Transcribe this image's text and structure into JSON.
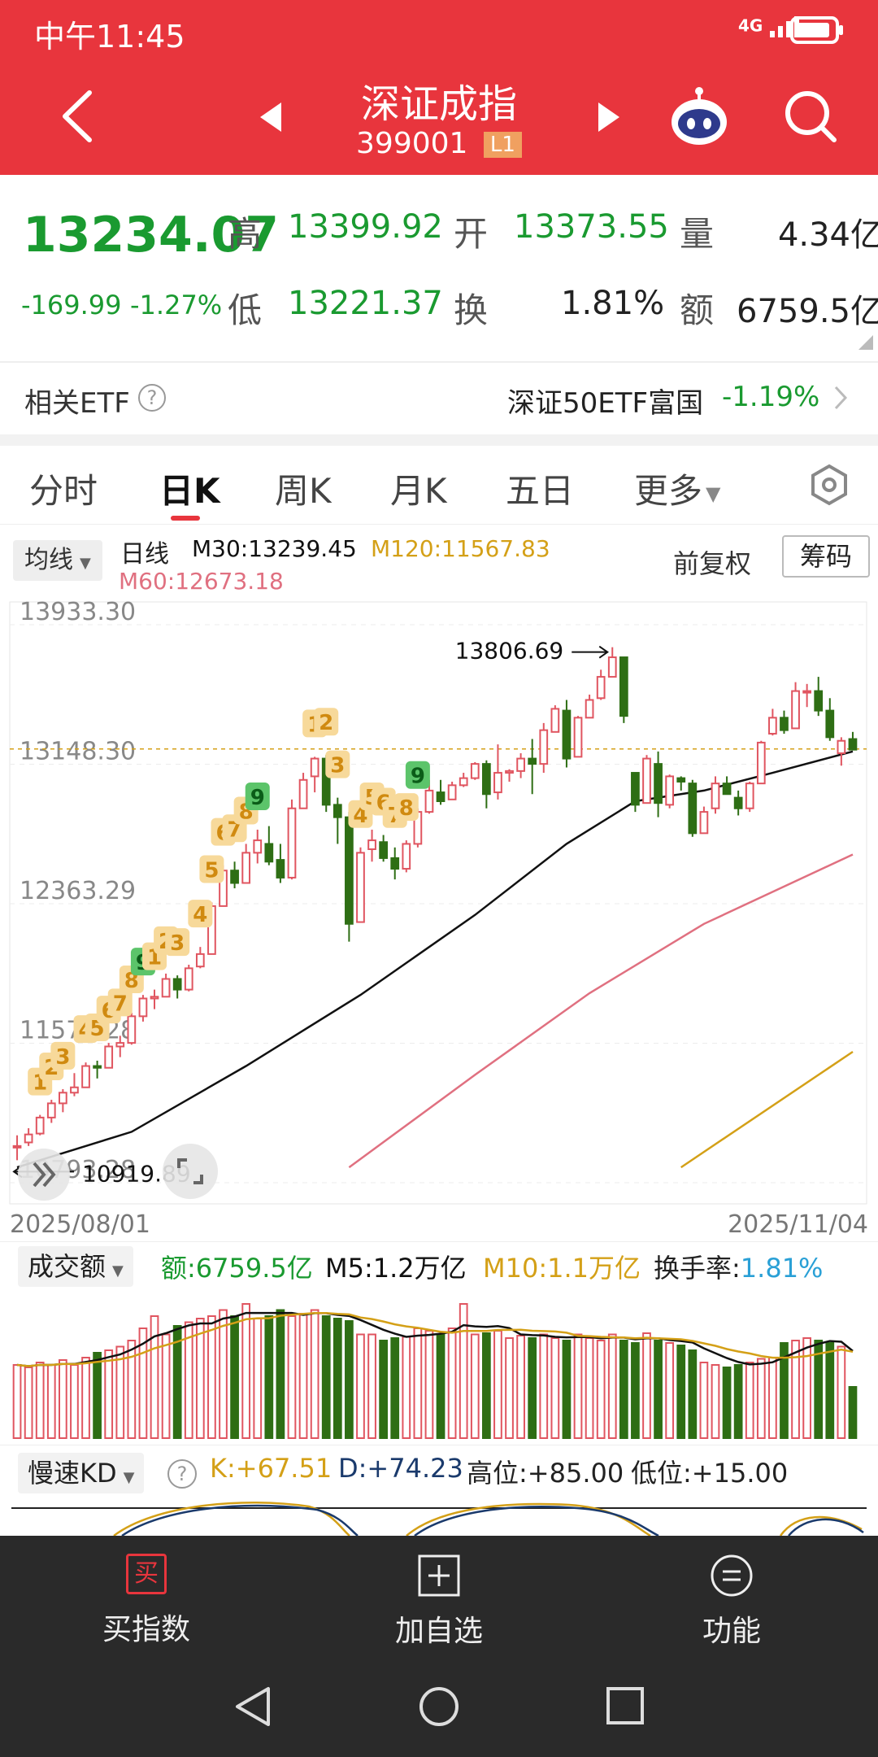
{
  "status_bar": {
    "time": "中午11:45",
    "signal": "4G",
    "battery": "battery"
  },
  "header": {
    "title": "深证成指",
    "code": "399001",
    "level_badge": "L1"
  },
  "quote": {
    "price": "13234.07",
    "change": "-169.99",
    "change_pct": "-1.27%",
    "high_label": "高",
    "high": "13399.92",
    "open_label": "开",
    "open": "13373.55",
    "volume_label": "量",
    "volume": "4.34亿",
    "low_label": "低",
    "low": "13221.37",
    "turnover_label": "换",
    "turnover": "1.81%",
    "amount_label": "额",
    "amount": "6759.5亿"
  },
  "etf": {
    "label": "相关ETF",
    "name": "深证50ETF富国",
    "change": "-1.19%"
  },
  "tabs": [
    "分时",
    "日K",
    "周K",
    "月K",
    "五日",
    "更多"
  ],
  "active_tab": 1,
  "indicator_bar": {
    "ma_selector": "均线",
    "period": "日线",
    "m30": "M30:13239.45",
    "m120": "M120:11567.83",
    "m60": "M60:12673.18",
    "adjust": "前复权",
    "chips": "筹码"
  },
  "colors": {
    "red": "#e8353d",
    "up": "#e05560",
    "down": "#2e6e14",
    "m30": "#111111",
    "m60": "#e07080",
    "m120": "#d4a017",
    "cyan": "#2aa0d6"
  },
  "chart_data": {
    "type": "candlestick",
    "ylim": [
      10793.28,
      13933.3
    ],
    "y_ticks": [
      "13933.30",
      "13148.30",
      "12363.29",
      "11578.28",
      "10793.28"
    ],
    "x_start": "2025/08/01",
    "x_end": "2025/11/04",
    "max_label": "13806.69",
    "min_label": "10919.89",
    "candles": [
      [
        11000,
        11000,
        10919.89,
        11060
      ],
      [
        11020,
        11065,
        11000,
        11100
      ],
      [
        11070,
        11160,
        11060,
        11175
      ],
      [
        11160,
        11240,
        11130,
        11260
      ],
      [
        11240,
        11300,
        11190,
        11320
      ],
      [
        11300,
        11330,
        11280,
        11410
      ],
      [
        11330,
        11450,
        11330,
        11470
      ],
      [
        11450,
        11440,
        11380,
        11480
      ],
      [
        11440,
        11560,
        11440,
        11580
      ],
      [
        11560,
        11580,
        11500,
        11620
      ],
      [
        11580,
        11730,
        11570,
        11750
      ],
      [
        11730,
        11830,
        11700,
        11850
      ],
      [
        11830,
        11840,
        11770,
        11880
      ],
      [
        11840,
        11940,
        11840,
        11970
      ],
      [
        11940,
        11880,
        11830,
        11960
      ],
      [
        11880,
        12000,
        11870,
        12020
      ],
      [
        12010,
        12080,
        12000,
        12120
      ],
      [
        12080,
        12350,
        12080,
        12370
      ],
      [
        12350,
        12550,
        12350,
        12580
      ],
      [
        12550,
        12480,
        12450,
        12600
      ],
      [
        12480,
        12650,
        12480,
        12700
      ],
      [
        12650,
        12720,
        12590,
        12780
      ],
      [
        12700,
        12600,
        12580,
        12800
      ],
      [
        12610,
        12510,
        12480,
        12700
      ],
      [
        12510,
        12900,
        12500,
        12950
      ],
      [
        12900,
        13060,
        12900,
        13100
      ],
      [
        13080,
        13180,
        12990,
        13190
      ],
      [
        13180,
        12920,
        12880,
        13200
      ],
      [
        12920,
        12850,
        12700,
        12960
      ],
      [
        12850,
        12250,
        12150,
        12880
      ],
      [
        12260,
        12650,
        12260,
        12680
      ],
      [
        12670,
        12720,
        12600,
        12780
      ],
      [
        12710,
        12620,
        12600,
        12750
      ],
      [
        12620,
        12560,
        12500,
        12680
      ],
      [
        12560,
        12700,
        12540,
        12720
      ],
      [
        12700,
        12880,
        12680,
        12900
      ],
      [
        12880,
        13000,
        12870,
        13060
      ],
      [
        12990,
        12940,
        12920,
        13060
      ],
      [
        12950,
        13030,
        12950,
        13050
      ],
      [
        13030,
        13070,
        13020,
        13100
      ],
      [
        13070,
        13150,
        13060,
        13160
      ],
      [
        13150,
        12980,
        12900,
        13170
      ],
      [
        12990,
        13100,
        12950,
        13260
      ],
      [
        13100,
        13110,
        13050,
        13120
      ],
      [
        13110,
        13180,
        13070,
        13210
      ],
      [
        13180,
        13150,
        12980,
        13290
      ],
      [
        13150,
        13340,
        13100,
        13380
      ],
      [
        13330,
        13460,
        13330,
        13480
      ],
      [
        13450,
        13180,
        13130,
        13510
      ],
      [
        13190,
        13410,
        13190,
        13420
      ],
      [
        13410,
        13510,
        13410,
        13540
      ],
      [
        13520,
        13640,
        13510,
        13680
      ],
      [
        13640,
        13750,
        13640,
        13806.69
      ],
      [
        13750,
        13420,
        13380,
        13750
      ],
      [
        13100,
        12920,
        12880,
        13100
      ],
      [
        12930,
        13180,
        12930,
        13200
      ],
      [
        13150,
        12930,
        12850,
        13220
      ],
      [
        12920,
        13080,
        12900,
        13090
      ],
      [
        13070,
        13050,
        13000,
        13080
      ],
      [
        13040,
        12760,
        12740,
        13060
      ],
      [
        12760,
        12880,
        12760,
        12910
      ],
      [
        12900,
        13040,
        12870,
        13080
      ],
      [
        13040,
        12980,
        12980,
        13080
      ],
      [
        12960,
        12900,
        12860,
        13000
      ],
      [
        12900,
        13040,
        12880,
        13050
      ],
      [
        13040,
        13270,
        13040,
        13280
      ],
      [
        13320,
        13410,
        13310,
        13460
      ],
      [
        13410,
        13340,
        13320,
        13450
      ],
      [
        13350,
        13560,
        13350,
        13610
      ],
      [
        13560,
        13560,
        13470,
        13600
      ],
      [
        13560,
        13450,
        13420,
        13640
      ],
      [
        13450,
        13300,
        13280,
        13520
      ],
      [
        13210,
        13280,
        13140,
        13300
      ],
      [
        13290,
        13230,
        13230,
        13330
      ]
    ],
    "m30": [
      [
        0,
        10880
      ],
      [
        10,
        11080
      ],
      [
        20,
        11450
      ],
      [
        30,
        11850
      ],
      [
        40,
        12300
      ],
      [
        48,
        12700
      ],
      [
        54,
        12940
      ],
      [
        60,
        13000
      ],
      [
        66,
        13100
      ],
      [
        73,
        13220
      ]
    ],
    "m60": [
      [
        29,
        10880
      ],
      [
        40,
        11400
      ],
      [
        50,
        11860
      ],
      [
        60,
        12250
      ],
      [
        73,
        12640
      ]
    ],
    "m120": [
      [
        58,
        10880
      ],
      [
        73,
        11530
      ]
    ],
    "last_price_line": 13234.07,
    "labels": [
      {
        "i": 2,
        "t": "1",
        "c": "o"
      },
      {
        "i": 3,
        "t": "2",
        "c": "o"
      },
      {
        "i": 4,
        "t": "3",
        "c": "o"
      },
      {
        "i": 6,
        "t": "4",
        "c": "o"
      },
      {
        "i": 7,
        "t": "5",
        "c": "o"
      },
      {
        "i": 8,
        "t": "6",
        "c": "o"
      },
      {
        "i": 9,
        "t": "7",
        "c": "o"
      },
      {
        "i": 10,
        "t": "8",
        "c": "o"
      },
      {
        "i": 11,
        "t": "9",
        "c": "g"
      },
      {
        "i": 12,
        "t": "1",
        "c": "o"
      },
      {
        "i": 13,
        "t": "2",
        "c": "o"
      },
      {
        "i": 14,
        "t": "3",
        "c": "o"
      },
      {
        "i": 16,
        "t": "4",
        "c": "o"
      },
      {
        "i": 17,
        "t": "5",
        "c": "o"
      },
      {
        "i": 18,
        "t": "6",
        "c": "o"
      },
      {
        "i": 19,
        "t": "7",
        "c": "o"
      },
      {
        "i": 20,
        "t": "8",
        "c": "o"
      },
      {
        "i": 21,
        "t": "9",
        "c": "g"
      },
      {
        "i": 26,
        "t": "1",
        "c": "o"
      },
      {
        "i": 27,
        "t": "2",
        "c": "o"
      },
      {
        "i": 28,
        "t": "3",
        "c": "o"
      },
      {
        "i": 30,
        "t": "4",
        "c": "o"
      },
      {
        "i": 31,
        "t": "5",
        "c": "o"
      },
      {
        "i": 32,
        "t": "6",
        "c": "o"
      },
      {
        "i": 33,
        "t": "7",
        "c": "o"
      },
      {
        "i": 34,
        "t": "8",
        "c": "o"
      },
      {
        "i": 35,
        "t": "9",
        "c": "g"
      }
    ]
  },
  "volume": {
    "selector": "成交额",
    "amount": "额:6759.5亿",
    "m5": "M5:1.2万亿",
    "m10": "M10:1.1万亿",
    "turnover_label": "换手率:",
    "turnover": "1.81%",
    "bars": [
      0.6,
      0.58,
      0.62,
      0.6,
      0.64,
      0.6,
      0.66,
      0.7,
      0.72,
      0.75,
      0.8,
      0.9,
      1.0,
      0.85,
      0.92,
      0.95,
      0.98,
      1.0,
      1.05,
      1.0,
      1.1,
      0.98,
      1.0,
      1.05,
      1.0,
      1.02,
      1.05,
      1.0,
      0.98,
      0.96,
      0.85,
      0.85,
      0.8,
      0.82,
      0.83,
      0.9,
      0.88,
      0.85,
      0.9,
      1.1,
      0.85,
      0.86,
      0.88,
      0.82,
      0.84,
      0.82,
      0.85,
      0.82,
      0.8,
      0.85,
      0.82,
      0.8,
      0.85,
      0.8,
      0.78,
      0.86,
      0.8,
      0.78,
      0.76,
      0.72,
      0.62,
      0.6,
      0.58,
      0.6,
      0.62,
      0.65,
      0.66,
      0.78,
      0.8,
      0.82,
      0.8,
      0.78,
      0.75,
      0.42
    ]
  },
  "kd": {
    "selector": "慢速KD",
    "k": "K:+67.51",
    "d": "D:+74.23",
    "high": "高位:+85.00",
    "low": "低位:+15.00"
  },
  "bottom_nav": {
    "buy_icon": "买",
    "buy": "买指数",
    "add": "加自选",
    "func": "功能"
  }
}
